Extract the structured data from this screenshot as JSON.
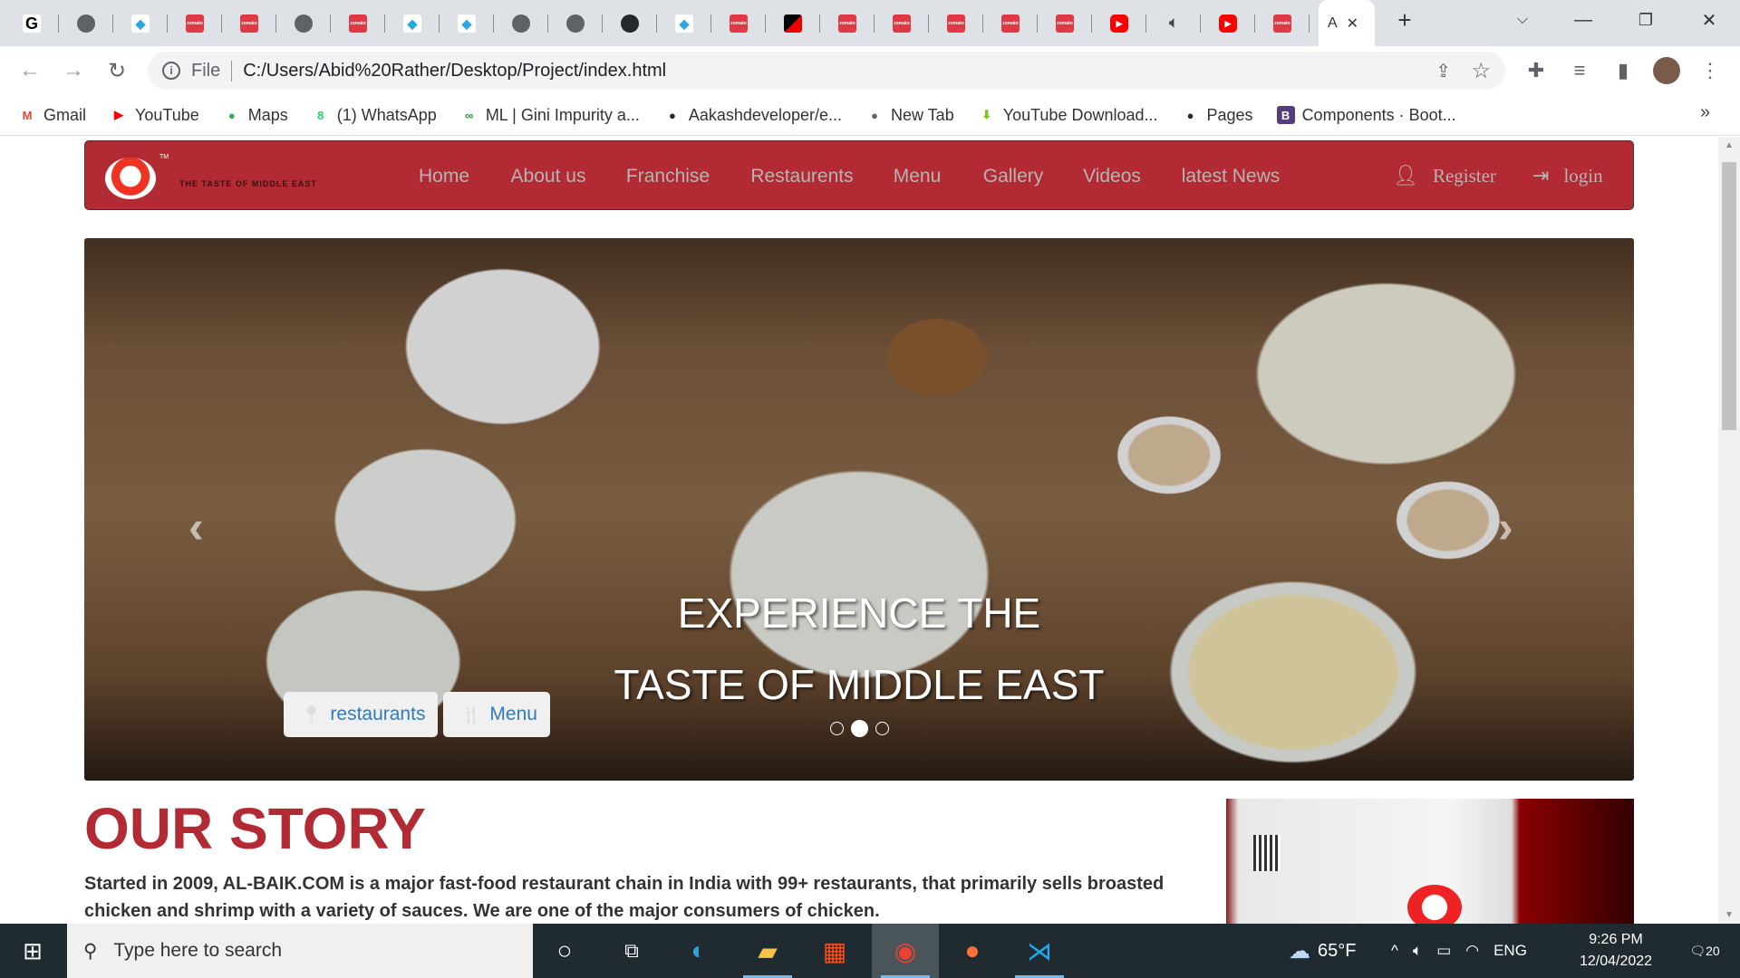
{
  "browser": {
    "tabs": [
      {
        "icon": "google"
      },
      {
        "icon": "globe"
      },
      {
        "icon": "drop"
      },
      {
        "icon": "zomato"
      },
      {
        "icon": "zomato"
      },
      {
        "icon": "globe"
      },
      {
        "icon": "zomato"
      },
      {
        "icon": "drop"
      },
      {
        "icon": "drop"
      },
      {
        "icon": "globe"
      },
      {
        "icon": "globe"
      },
      {
        "icon": "github"
      },
      {
        "icon": "drop"
      },
      {
        "icon": "zomato"
      },
      {
        "icon": "black"
      },
      {
        "icon": "zomato"
      },
      {
        "icon": "zomato"
      },
      {
        "icon": "zomato"
      },
      {
        "icon": "zomato"
      },
      {
        "icon": "zomato"
      },
      {
        "icon": "yt"
      },
      {
        "icon": "audio"
      },
      {
        "icon": "yt"
      },
      {
        "icon": "zomato"
      }
    ],
    "active_tab_label": "A",
    "address": {
      "scheme_label": "File",
      "url": "C:/Users/Abid%20Rather/Desktop/Project/index.html"
    },
    "bookmarks": [
      {
        "label": "Gmail",
        "icon": "gmail-icon",
        "glyph": "M",
        "color": "#ea4335"
      },
      {
        "label": "YouTube",
        "icon": "youtube-icon",
        "glyph": "▶",
        "color": "#ff0000"
      },
      {
        "label": "Maps",
        "icon": "maps-icon",
        "glyph": "●",
        "color": "#34a853"
      },
      {
        "label": "(1) WhatsApp",
        "icon": "whatsapp-icon",
        "glyph": "8",
        "color": "#25d366"
      },
      {
        "label": "ML | Gini Impurity a...",
        "icon": "geeksforgeeks-icon",
        "glyph": "∞",
        "color": "#2f8d46"
      },
      {
        "label": "Aakashdeveloper/e...",
        "icon": "github-icon",
        "glyph": "●",
        "color": "#24292e"
      },
      {
        "label": "New Tab",
        "icon": "globe-icon",
        "glyph": "●",
        "color": "#5f6368"
      },
      {
        "label": "YouTube Download...",
        "icon": "download-icon",
        "glyph": "⬇",
        "color": "#7cc520"
      },
      {
        "label": "Pages",
        "icon": "github-icon",
        "glyph": "●",
        "color": "#24292e"
      },
      {
        "label": "Components · Boot...",
        "icon": "bootstrap-icon",
        "glyph": "B",
        "color": "#563d7c"
      }
    ]
  },
  "site": {
    "logo_tagline": "THE TASTE OF MIDDLE EAST",
    "logo_tm": "TM",
    "nav": [
      "Home",
      "About us",
      "Franchise",
      "Restaurents",
      "Menu",
      "Gallery",
      "Videos",
      "latest News"
    ],
    "register": "Register",
    "login": "login",
    "hero": {
      "line1": "EXPERIENCE THE",
      "line2": "TASTE OF MIDDLE EAST",
      "btn_restaurants": "restaurants",
      "btn_menu": "Menu",
      "active_slide": 2,
      "slide_count": 3
    },
    "story": {
      "title": "OUR STORY",
      "text_before": "Started in 2009, ",
      "brand": "AL-BAIK.COM",
      "text_after": " is a major fast-food restaurant chain in India with 99+ restaurants, that primarily sells broasted chicken and shrimp with a variety of sauces. We are one of the major consumers of chicken."
    },
    "brand_color": "#b22a34"
  },
  "taskbar": {
    "search_placeholder": "Type here to search",
    "weather": "65°F",
    "lang": "ENG",
    "time": "9:26 PM",
    "date": "12/04/2022",
    "notifications": "20"
  }
}
